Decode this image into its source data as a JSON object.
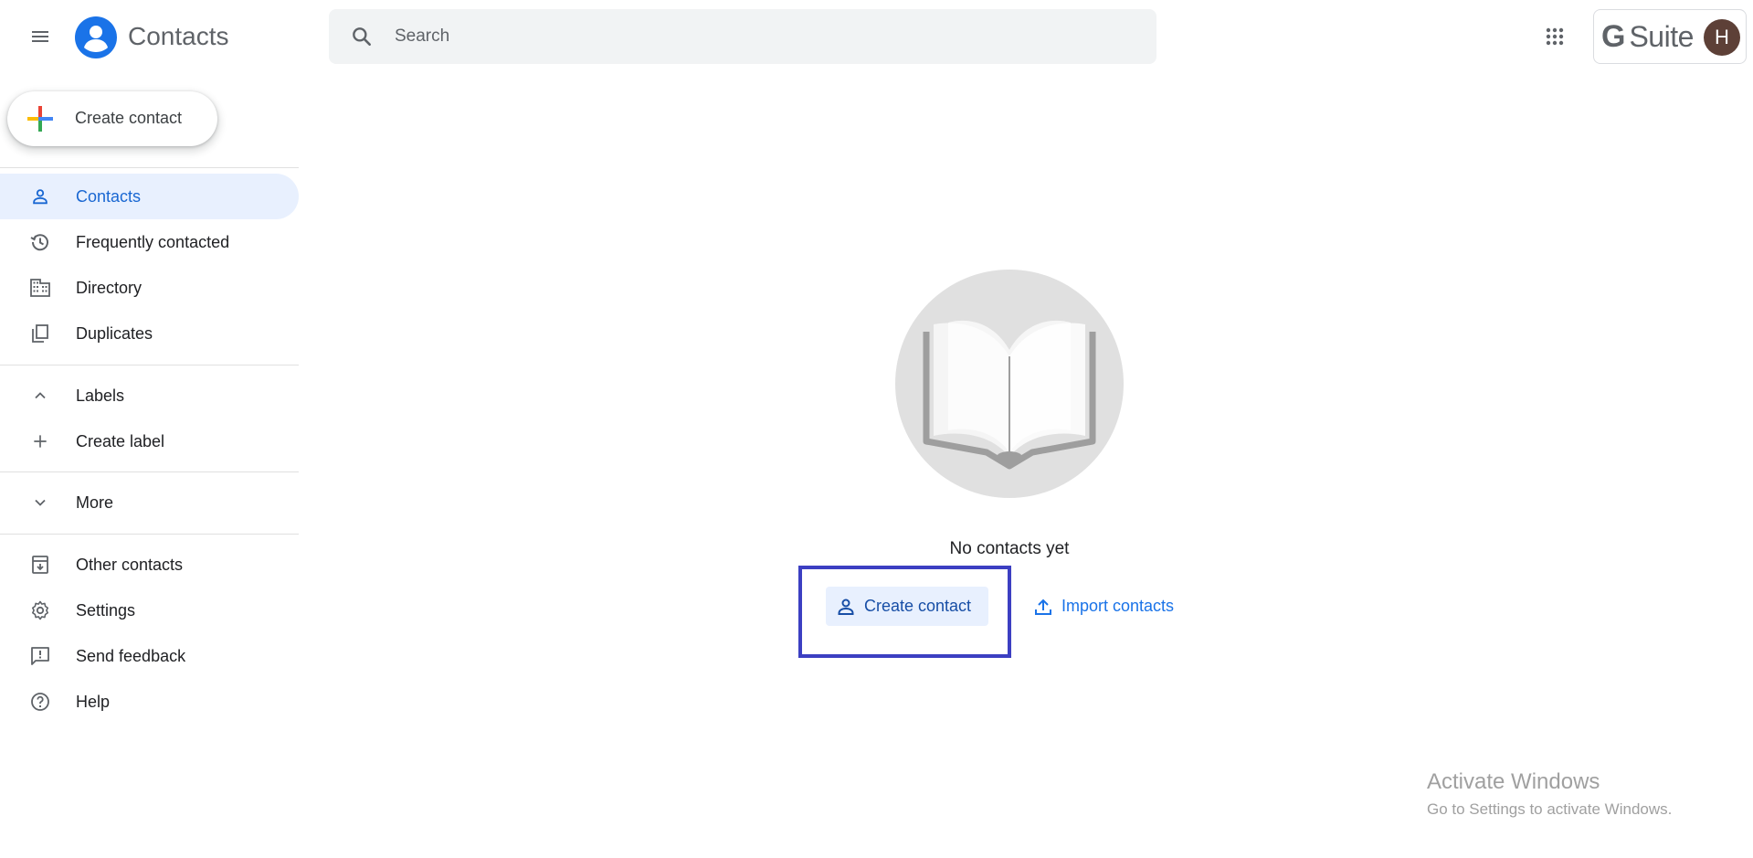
{
  "header": {
    "app_title": "Contacts",
    "search_placeholder": "Search",
    "gsuite_g": "G",
    "gsuite_text": "Suite",
    "avatar_letter": "H",
    "colors": {
      "logo_blue": "#1a73e8",
      "avatar_bg": "#5d4037"
    }
  },
  "sidebar": {
    "create_label": "Create contact",
    "items": [
      {
        "label": "Contacts",
        "icon": "person-icon",
        "active": true
      },
      {
        "label": "Frequently contacted",
        "icon": "history-icon"
      },
      {
        "label": "Directory",
        "icon": "domain-icon"
      },
      {
        "label": "Duplicates",
        "icon": "copy-icon"
      }
    ],
    "labels_header": "Labels",
    "create_label_item": "Create label",
    "more": "More",
    "footer_items": [
      {
        "label": "Other contacts",
        "icon": "archive-icon"
      },
      {
        "label": "Settings",
        "icon": "gear-icon"
      },
      {
        "label": "Send feedback",
        "icon": "feedback-icon"
      },
      {
        "label": "Help",
        "icon": "help-icon"
      }
    ]
  },
  "main": {
    "empty_message": "No contacts yet",
    "create_button": "Create contact",
    "import_button": "Import contacts",
    "colors": {
      "highlight": "#3c3fc2",
      "link": "#1a73e8"
    }
  },
  "watermark": {
    "title": "Activate Windows",
    "subtitle": "Go to Settings to activate Windows."
  }
}
